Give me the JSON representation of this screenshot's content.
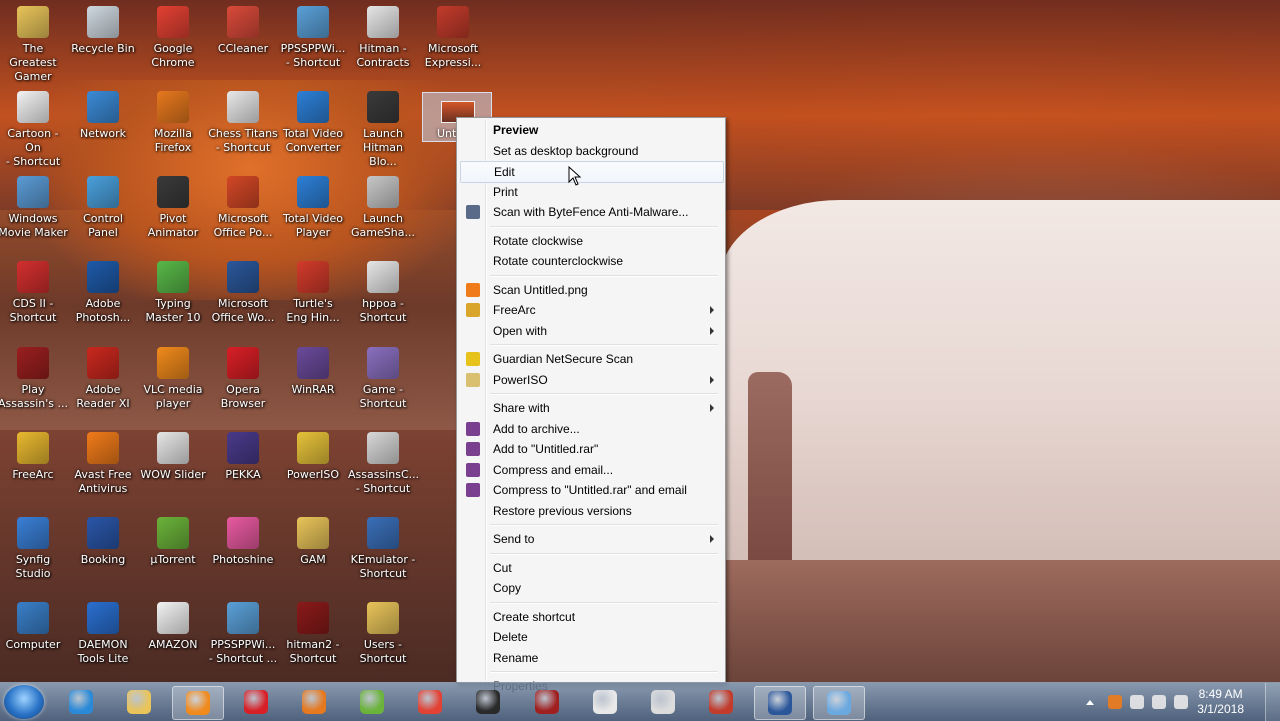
{
  "desktop_icons": [
    {
      "label": "The Greatest\nGamer",
      "icon": "folder-icon",
      "color": "#e8c45a"
    },
    {
      "label": "Recycle Bin",
      "icon": "recycle-bin-icon",
      "color": "#cfd8e0"
    },
    {
      "label": "Google\nChrome",
      "icon": "chrome-icon",
      "color": "#e34133"
    },
    {
      "label": "CCleaner",
      "icon": "ccleaner-icon",
      "color": "#d94a3a"
    },
    {
      "label": "PPSSPPWi...\n- Shortcut",
      "icon": "ppsspp-icon",
      "color": "#5aa0d8"
    },
    {
      "label": "Hitman -\nContracts",
      "icon": "hitman-icon",
      "color": "#e6e6e6"
    },
    {
      "label": "Microsoft\nExpressi...",
      "icon": "webcam-icon",
      "color": "#c23b2b"
    },
    {
      "label": "Cartoon - On\n- Shortcut",
      "icon": "document-icon",
      "color": "#f2f2f2"
    },
    {
      "label": "Network",
      "icon": "network-icon",
      "color": "#3b8ad6"
    },
    {
      "label": "Mozilla\nFirefox",
      "icon": "firefox-icon",
      "color": "#e6781e"
    },
    {
      "label": "Chess Titans\n- Shortcut",
      "icon": "chess-icon",
      "color": "#e8e8e8"
    },
    {
      "label": "Total Video\nConverter",
      "icon": "video-converter-icon",
      "color": "#2d7fd6"
    },
    {
      "label": "Launch\nHitman Blo...",
      "icon": "hitman-blood-icon",
      "color": "#3a3a3a"
    },
    {
      "label": "Windows\nMovie Maker",
      "icon": "movie-maker-icon",
      "color": "#5b9bd5"
    },
    {
      "label": "Control\nPanel",
      "icon": "control-panel-icon",
      "color": "#4aa0dc"
    },
    {
      "label": "Pivot\nAnimator",
      "icon": "pivot-icon",
      "color": "#3a3a3a"
    },
    {
      "label": "Microsoft\nOffice Po...",
      "icon": "powerpoint-icon",
      "color": "#d24726"
    },
    {
      "label": "Total Video\nPlayer",
      "icon": "video-player-icon",
      "color": "#2d7fd6"
    },
    {
      "label": "Launch\nGameSha...",
      "icon": "gameshark-icon",
      "color": "#c7c7c7"
    },
    {
      "label": "CDS II -\nShortcut",
      "icon": "cds-icon",
      "color": "#d32f2f"
    },
    {
      "label": "Adobe\nPhotosh...",
      "icon": "photoshop-icon",
      "color": "#1e5aa8"
    },
    {
      "label": "Typing\nMaster 10",
      "icon": "typing-master-icon",
      "color": "#58b848"
    },
    {
      "label": "Microsoft\nOffice Wo...",
      "icon": "word-icon",
      "color": "#2b579a"
    },
    {
      "label": "Turtle's\nEng Hin...",
      "icon": "turtle-icon",
      "color": "#d23b2b"
    },
    {
      "label": "hppoa -\nShortcut",
      "icon": "document-icon",
      "color": "#e6e6e6"
    },
    {
      "label": "Play\nAssassin's ...",
      "icon": "assassins-creed-icon",
      "color": "#9a1f1f"
    },
    {
      "label": "Adobe\nReader XI",
      "icon": "adobe-reader-icon",
      "color": "#c9281e"
    },
    {
      "label": "VLC media\nplayer",
      "icon": "vlc-icon",
      "color": "#f08a1c"
    },
    {
      "label": "Opera\nBrowser",
      "icon": "opera-icon",
      "color": "#d81f26"
    },
    {
      "label": "WinRAR",
      "icon": "winrar-icon",
      "color": "#6a4a9a"
    },
    {
      "label": "Game -\nShortcut",
      "icon": "game-icon",
      "color": "#8a6fbf"
    },
    {
      "label": "FreeArc",
      "icon": "freearc-icon",
      "color": "#e8b830"
    },
    {
      "label": "Avast Free\nAntivirus",
      "icon": "avast-icon",
      "color": "#f07b1a"
    },
    {
      "label": "WOW Slider",
      "icon": "wow-slider-icon",
      "color": "#e6e6e6"
    },
    {
      "label": "PEKKA",
      "icon": "pekka-icon",
      "color": "#4a3a8a"
    },
    {
      "label": "PowerISO",
      "icon": "poweriso-icon",
      "color": "#e6c23a"
    },
    {
      "label": "AssassinsC...\n- Shortcut",
      "icon": "assassins-creed-icon",
      "color": "#d8d8d8"
    },
    {
      "label": "Synfig Studio",
      "icon": "synfig-icon",
      "color": "#3a7fd6"
    },
    {
      "label": "Booking",
      "icon": "booking-icon",
      "color": "#2a56a8"
    },
    {
      "label": "µTorrent",
      "icon": "utorrent-icon",
      "color": "#6bb33a"
    },
    {
      "label": "Photoshine",
      "icon": "photoshine-icon",
      "color": "#e85aa0"
    },
    {
      "label": "GAM",
      "icon": "folder-icon",
      "color": "#e8c45a"
    },
    {
      "label": "KEmulator -\nShortcut",
      "icon": "kemulator-icon",
      "color": "#3a6fb8"
    },
    {
      "label": "Computer",
      "icon": "computer-icon",
      "color": "#3a7fc8"
    },
    {
      "label": "DAEMON\nTools Lite",
      "icon": "daemon-tools-icon",
      "color": "#2a6fd0"
    },
    {
      "label": "AMAZON",
      "icon": "document-icon",
      "color": "#f2f2f2"
    },
    {
      "label": "PPSSPPWi...\n- Shortcut ...",
      "icon": "ppsspp-icon",
      "color": "#5aa0d8"
    },
    {
      "label": "hitman2 -\nShortcut",
      "icon": "hitman-icon",
      "color": "#8a1a1a"
    },
    {
      "label": "Users -\nShortcut",
      "icon": "folder-icon",
      "color": "#e8c45a"
    }
  ],
  "selected_file": {
    "label": "Unti",
    "icon": "image-file-icon"
  },
  "context_menu": {
    "items": [
      {
        "label": "Preview",
        "bold": true
      },
      {
        "label": "Set as desktop background"
      },
      {
        "label": "Edit",
        "highlighted": true
      },
      {
        "label": "Print"
      },
      {
        "label": "Scan with ByteFence Anti-Malware...",
        "icon": "bytefence-icon",
        "icon_color": "#5a6b8a"
      },
      {
        "separator": true
      },
      {
        "label": "Rotate clockwise"
      },
      {
        "label": "Rotate counterclockwise"
      },
      {
        "separator": true
      },
      {
        "label": "Scan Untitled.png",
        "icon": "avast-icon",
        "icon_color": "#f07b1a"
      },
      {
        "label": "FreeArc",
        "icon": "freearc-icon",
        "icon_color": "#d9a52a",
        "submenu": true
      },
      {
        "label": "Open with",
        "submenu": true
      },
      {
        "separator": true
      },
      {
        "label": "Guardian NetSecure Scan",
        "icon": "shield-icon",
        "icon_color": "#e6c21a"
      },
      {
        "label": "PowerISO",
        "icon": "poweriso-icon",
        "icon_color": "#d8c070",
        "submenu": true
      },
      {
        "separator": true
      },
      {
        "label": "Share with",
        "submenu": true
      },
      {
        "label": "Add to archive...",
        "icon": "winrar-icon",
        "icon_color": "#7a3f8f"
      },
      {
        "label": "Add to \"Untitled.rar\"",
        "icon": "winrar-icon",
        "icon_color": "#7a3f8f"
      },
      {
        "label": "Compress and email...",
        "icon": "winrar-icon",
        "icon_color": "#7a3f8f"
      },
      {
        "label": "Compress to \"Untitled.rar\" and email",
        "icon": "winrar-icon",
        "icon_color": "#7a3f8f"
      },
      {
        "label": "Restore previous versions"
      },
      {
        "separator": true
      },
      {
        "label": "Send to",
        "submenu": true
      },
      {
        "separator": true
      },
      {
        "label": "Cut"
      },
      {
        "label": "Copy"
      },
      {
        "separator": true
      },
      {
        "label": "Create shortcut"
      },
      {
        "label": "Delete"
      },
      {
        "label": "Rename"
      },
      {
        "separator": true
      },
      {
        "label": "Properties"
      }
    ]
  },
  "taskbar": {
    "pinned": [
      {
        "name": "internet-explorer-icon",
        "color": "#2a8ad8"
      },
      {
        "name": "file-explorer-icon",
        "color": "#e8c45a"
      },
      {
        "name": "media-player-icon",
        "color": "#f08a1c",
        "active": true
      },
      {
        "name": "opera-icon",
        "color": "#d81f26"
      },
      {
        "name": "firefox-icon",
        "color": "#e6781e"
      },
      {
        "name": "utorrent-icon",
        "color": "#6bb33a"
      },
      {
        "name": "chrome-icon",
        "color": "#e34133"
      },
      {
        "name": "assassins-creed-icon",
        "color": "#2a2a2a"
      },
      {
        "name": "assassins-creed-icon",
        "color": "#a01f1f"
      },
      {
        "name": "assassins-creed-icon",
        "color": "#e8e8e8"
      },
      {
        "name": "assassins-creed-icon",
        "color": "#dcdcdc"
      },
      {
        "name": "webcam-icon",
        "color": "#c23b2b"
      },
      {
        "name": "word-icon",
        "color": "#2b579a",
        "active": true
      },
      {
        "name": "paint-icon",
        "color": "#6aa8e0",
        "active": true
      }
    ],
    "clock": {
      "time": "8:49 AM",
      "date": "3/1/2018"
    },
    "tray_icons": [
      "show-hidden-icon",
      "avast-tray-icon",
      "volume-icon",
      "network-signal-icon",
      "flag-icon"
    ]
  }
}
